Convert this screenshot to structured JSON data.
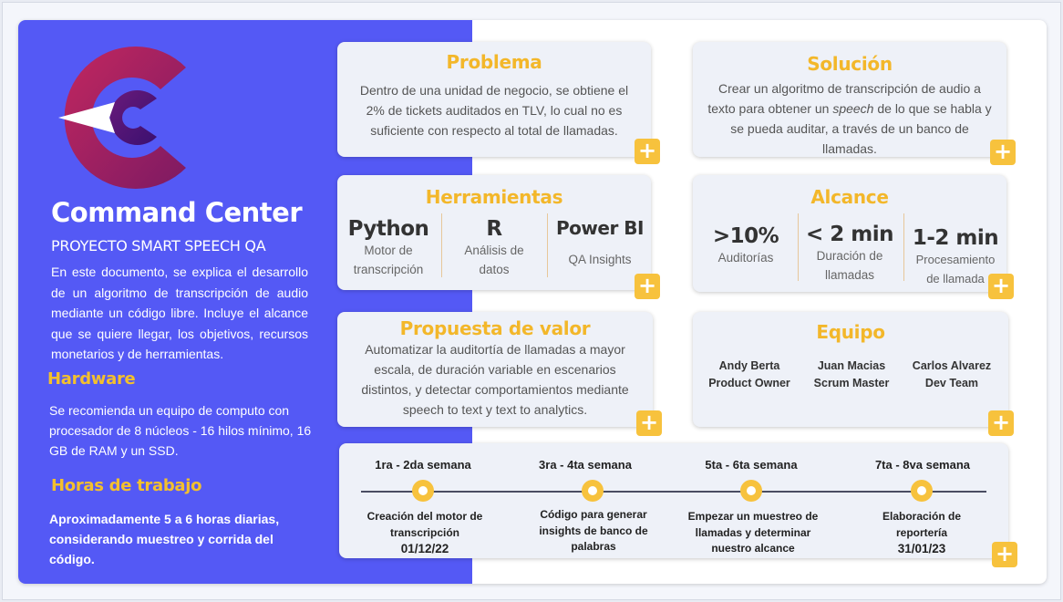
{
  "left": {
    "title": "Command Center",
    "subtitle": "PROYECTO SMART SPEECH QA",
    "description": "En este documento, se explica el desarrollo de un algoritmo de transcripción de audio mediante un código libre. Incluye el alcance que se quiere llegar, los objetivos, recursos monetarios y de herramientas.",
    "hardware_heading": "Hardware",
    "hardware_text": "Se recomienda un equipo de computo con procesador de 8 núcleos - 16 hilos mínimo, 16 GB de RAM y un SSD.",
    "hours_heading": "Horas de trabajo",
    "hours_text": "Aproximadamente 5 a 6 horas diarias, considerando muestreo y corrida del código."
  },
  "problema": {
    "heading": "Problema",
    "text": "Dentro de una unidad de negocio, se obtiene el 2% de tickets auditados en TLV, lo cual no es suficiente con respecto al total de llamadas."
  },
  "solucion": {
    "heading": "Solución",
    "text_before": "Crear un algoritmo de transcripción de audio a texto para obtener un ",
    "text_em": "speech",
    "text_after": " de lo que se habla y se pueda auditar, a través de un banco de llamadas."
  },
  "herramientas": {
    "heading": "Herramientas",
    "items": [
      {
        "name": "Python",
        "desc": "Motor de transcripción"
      },
      {
        "name": "R",
        "desc": "Análisis de datos"
      },
      {
        "name": "Power BI",
        "desc": "QA Insights"
      }
    ]
  },
  "alcance": {
    "heading": "Alcance",
    "items": [
      {
        "value": ">10%",
        "desc": "Auditorías"
      },
      {
        "value": "< 2 min",
        "desc": "Duración de llamadas"
      },
      {
        "value": "1-2 min",
        "desc": "Procesamiento de llamada"
      }
    ]
  },
  "propuesta": {
    "heading": "Propuesta de valor",
    "text": "Automatizar la auditortía de llamadas a mayor escala, de duración variable en escenarios distintos, y detectar comportamientos mediante speech to text y text to analytics."
  },
  "equipo": {
    "heading": "Equipo",
    "members": [
      {
        "name": "Andy Berta",
        "role": "Product Owner"
      },
      {
        "name": "Juan Macias",
        "role": "Scrum Master"
      },
      {
        "name": "Carlos Alvarez",
        "role": "Dev Team"
      }
    ]
  },
  "timeline": {
    "phases": [
      {
        "label": "1ra - 2da semana",
        "desc": "Creación del motor de transcripción",
        "date": "01/12/22"
      },
      {
        "label": "3ra - 4ta semana",
        "desc": "Código para generar insights de banco de palabras",
        "date": ""
      },
      {
        "label": "5ta - 6ta semana",
        "desc": "Empezar un muestreo de llamadas  y determinar nuestro alcance",
        "date": ""
      },
      {
        "label": "7ta - 8va semana",
        "desc": "Elaboración de reportería",
        "date": "31/01/23"
      }
    ]
  },
  "plus_glyph": "+",
  "colors": {
    "left_panel": "#5459f5",
    "accent": "#f3b72a",
    "logo_crimson": "#b01f5f",
    "card_bg": "#eef1f8"
  },
  "icons": [
    "command-center-logo",
    "plus-icon"
  ]
}
